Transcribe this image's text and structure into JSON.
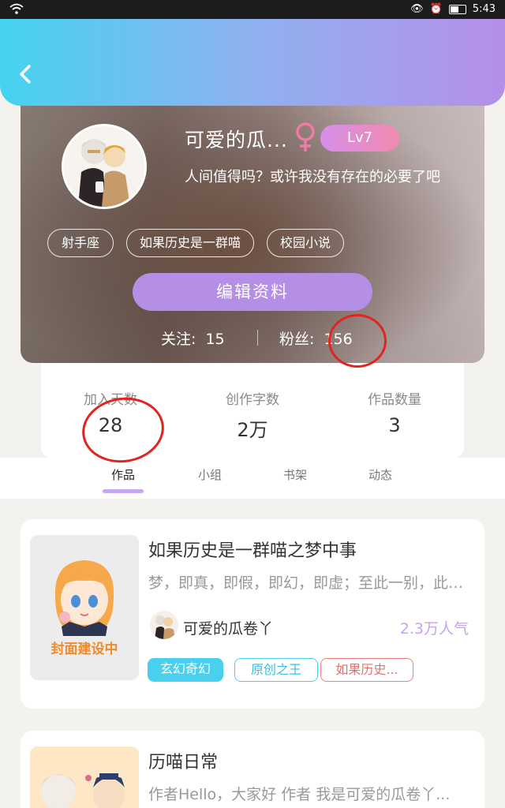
{
  "status_bar": {
    "time": "5:43"
  },
  "profile": {
    "username": "可爱的瓜...",
    "gender_symbol": "♀",
    "level": "Lv7",
    "bio": "人间值得吗？或许我没有存在的必要了吧",
    "tags": [
      "射手座",
      "如果历史是一群喵",
      "校园小说"
    ],
    "edit_label": "编辑资料",
    "follow_label": "关注:",
    "follow_count": "15",
    "fans_label": "粉丝:",
    "fans_count": "156"
  },
  "stats": [
    {
      "label": "加入天数",
      "value": "28"
    },
    {
      "label": "创作字数",
      "value": "2万"
    },
    {
      "label": "作品数量",
      "value": "3"
    }
  ],
  "tabs": [
    "作品",
    "小组",
    "书架",
    "动态"
  ],
  "works": [
    {
      "title": "如果历史是一群喵之梦中事",
      "desc": "梦，即真，即假，即幻，即虚；至此一别，此生便再也见不到了",
      "author": "可爱的瓜卷丫",
      "popularity": "2.3万人气",
      "cover_text": "封面建设中",
      "tags": [
        "玄幻奇幻",
        "原创之王",
        "如果历史..."
      ]
    },
    {
      "title": "历喵日常",
      "desc": "作者Hello，大家好 作者 我是可爱的瓜卷丫..."
    }
  ],
  "colors": {
    "header_start": "#45d3f0",
    "header_end": "#b58fe8",
    "accent_purple": "#b58fe6",
    "level_pink": "#f08bb0",
    "annotation_red": "#e0251f"
  }
}
